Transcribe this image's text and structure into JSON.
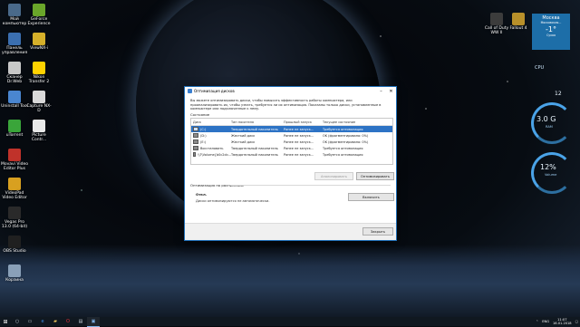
{
  "desktop_icons_left": [
    {
      "label": "Мой компьютер",
      "icon": "computer-icon"
    },
    {
      "label": "GeForce Experience",
      "icon": "geforce-icon"
    },
    {
      "label": "Панель управления",
      "icon": "control-panel-icon"
    },
    {
      "label": "ViewNX-i",
      "icon": "viewnx-icon"
    },
    {
      "label": "Сканер Dr.Web",
      "icon": "drweb-icon"
    },
    {
      "label": "Nikon Transfer 2",
      "icon": "nikon-icon"
    },
    {
      "label": "Uninstall Tool",
      "icon": "uninstall-icon"
    },
    {
      "label": "Capture NX-D",
      "icon": "capture-icon"
    },
    {
      "label": "uTorrent",
      "icon": "utorrent-icon"
    },
    {
      "label": "Picture Contr...",
      "icon": "picture-control-icon"
    },
    {
      "label": "Movavi Video Editor Plus",
      "icon": "movavi-icon"
    },
    {
      "label": "VideoPad Video Editor",
      "icon": "videopad-icon"
    },
    {
      "label": "Vegas Pro 13.0 (64-bit)",
      "icon": "vegas-icon"
    },
    {
      "label": "OBS Studio",
      "icon": "obs-icon"
    },
    {
      "label": "Корзина",
      "icon": "recycle-bin-icon"
    }
  ],
  "desktop_icons_right": [
    {
      "label": "Call of Duty WW II",
      "icon": "cod-icon"
    },
    {
      "label": "Fallout 4",
      "icon": "fallout-icon"
    }
  ],
  "dialog": {
    "title": "Оптимизация дисков",
    "description": "Вы можете оптимизировать диски, чтобы повысить эффективность работы компьютера, или проанализировать их, чтобы узнать, требуется ли их оптимизация. Показаны только диски, установленные в компьютере или подключенные к нему.",
    "status_label": "Состояние",
    "columns": [
      "Диск",
      "Тип носителя",
      "Прошлый запуск",
      "Текущее состояние"
    ],
    "rows": [
      {
        "disk": "(C:)",
        "media": "Твердотельный накопитель",
        "last": "Ранее не запуск...",
        "state": "Требуется оптимизация",
        "selected": true
      },
      {
        "disk": "(D:)",
        "media": "Жесткий диск",
        "last": "Ранее не запуск...",
        "state": "OK (фрагментировано: 0%)",
        "selected": false
      },
      {
        "disk": "(E:)",
        "media": "Жесткий диск",
        "last": "Ранее не запуск...",
        "state": "OK (фрагментировано: 0%)",
        "selected": false
      },
      {
        "disk": "Восстановить",
        "media": "Твердотельный накопитель",
        "last": "Ранее не запуск...",
        "state": "Требуется оптимизация",
        "selected": false
      },
      {
        "disk": "\\\\?\\Volume{b0c2cb...",
        "media": "Твердотельный накопитель",
        "last": "Ранее не запуск...",
        "state": "Требуется оптимизация",
        "selected": false
      }
    ],
    "analyze_button": "Анализировать",
    "optimize_button": "Оптимизировать",
    "schedule_title": "Оптимизация по расписанию",
    "schedule_state": "Откл.",
    "schedule_text": "Диски оптимизируются не автоматически.",
    "enable_button": "Включить",
    "close_button": "Закрыть"
  },
  "widgets": {
    "weather": {
      "city": "Москва",
      "region": "Московская...",
      "temp": "-1°",
      "condition": "Сухая"
    },
    "cpu_label": "CPU",
    "clock_display": "12",
    "ram_value": "3.0 G",
    "ram_label": "RAM",
    "volume_value": "12%",
    "volume_label": "Volume"
  },
  "taskbar": {
    "language": "ENG",
    "time": "11:07",
    "date": "16.01.2018"
  },
  "colors": {
    "dialog_border": "#1f6fb8",
    "selection": "#2d73c5",
    "weather_tile": "#1d6ea8"
  }
}
